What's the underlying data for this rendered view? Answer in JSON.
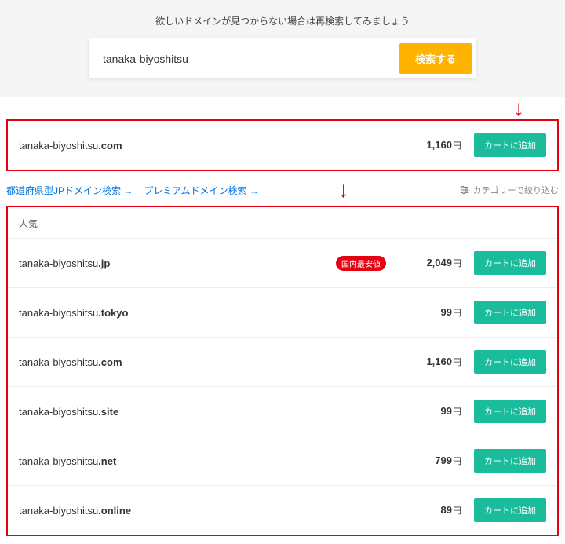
{
  "header": {
    "message": "欲しいドメインが見つからない場合は再検索してみましょう"
  },
  "search": {
    "value": "tanaka-biyoshitsu",
    "button": "検索する"
  },
  "featured": {
    "domain_base": "tanaka-biyoshitsu",
    "domain_tld": ".com",
    "price": "1,160",
    "currency": "円",
    "add_button": "カートに追加"
  },
  "links": {
    "l1": "都道府県型JPドメイン検索 →",
    "l2": "プレミアムドメイン検索 →",
    "filter": "カテゴリーで絞り込む"
  },
  "list": {
    "header": "人気",
    "rows": [
      {
        "base": "tanaka-biyoshitsu",
        "tld": ".jp",
        "badge": "国内最安値",
        "price": "2,049",
        "currency": "円",
        "btn": "カートに追加"
      },
      {
        "base": "tanaka-biyoshitsu",
        "tld": ".tokyo",
        "badge": null,
        "price": "99",
        "currency": "円",
        "btn": "カートに追加"
      },
      {
        "base": "tanaka-biyoshitsu",
        "tld": ".com",
        "badge": null,
        "price": "1,160",
        "currency": "円",
        "btn": "カートに追加"
      },
      {
        "base": "tanaka-biyoshitsu",
        "tld": ".site",
        "badge": null,
        "price": "99",
        "currency": "円",
        "btn": "カートに追加"
      },
      {
        "base": "tanaka-biyoshitsu",
        "tld": ".net",
        "badge": null,
        "price": "799",
        "currency": "円",
        "btn": "カートに追加"
      },
      {
        "base": "tanaka-biyoshitsu",
        "tld": ".online",
        "badge": null,
        "price": "89",
        "currency": "円",
        "btn": "カートに追加"
      }
    ]
  }
}
